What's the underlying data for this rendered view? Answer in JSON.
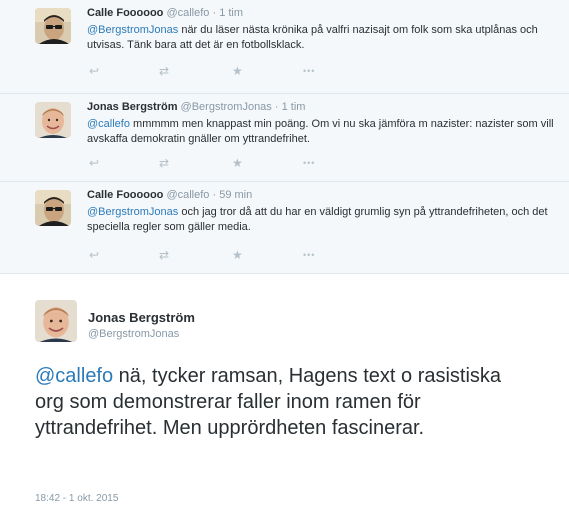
{
  "tweets": [
    {
      "name": "Calle Foooooo",
      "handle": "@callefo",
      "time": "· 1 tim",
      "mention": "@BergstromJonas",
      "text": " när du läser nästa krönika på valfri nazisajt om folk som ska utplånas och utvisas. Tänk bara att det är en fotbollsklack.",
      "avatar": "glasses-avatar"
    },
    {
      "name": "Jonas Bergström",
      "handle": "@BergstromJonas",
      "time": "· 1 tim",
      "mention": "@callefo",
      "text": " mmmmm men knappast min poäng. Om vi nu ska jämföra m nazister: nazister som vill avskaffa demokratin gnäller om yttrandefrihet.",
      "avatar": "smiling-avatar"
    },
    {
      "name": "Calle Foooooo",
      "handle": "@callefo",
      "time": "· 59 min",
      "mention": "@BergstromJonas",
      "text": " och jag tror då att du har en väldigt grumlig syn på yttrandefriheten, och det speciella regler som gäller media.",
      "avatar": "glasses-avatar"
    }
  ],
  "actions": {
    "reply": "↩",
    "retweet": "⇄",
    "favorite": "★",
    "more": "•••"
  },
  "main_tweet": {
    "name": "Jonas Bergström",
    "handle": "@BergstromJonas",
    "mention": "@callefo",
    "text": " nä, tycker ramsan, Hagens text o rasistiska org som demonstrerar faller inom ramen för yttrandefrihet. Men upprördheten fascinerar.",
    "timestamp": "18:42 - 1 okt. 2015"
  },
  "colors": {
    "link": "#2b7bb9",
    "muted": "#8899a6",
    "reply_bg": "#f5f8fa"
  }
}
